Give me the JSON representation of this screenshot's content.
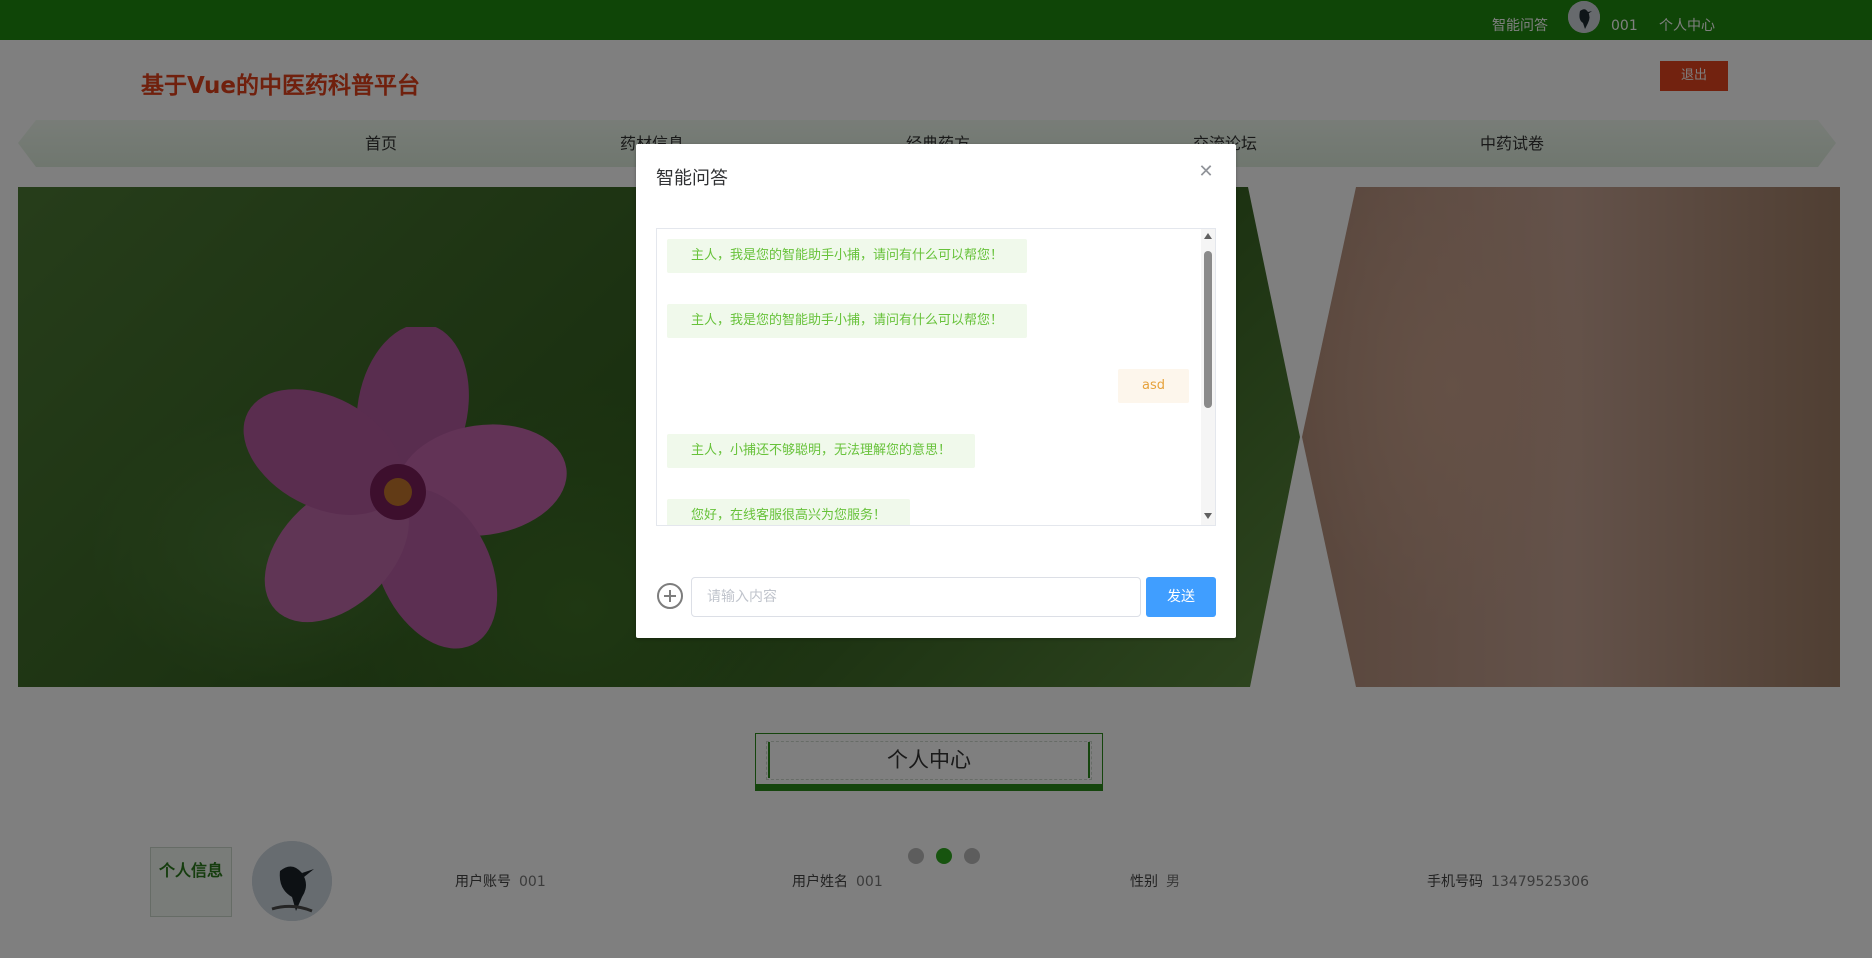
{
  "topbar": {
    "qa_link": "智能问答",
    "username": "001",
    "personal_center_link": "个人中心"
  },
  "header": {
    "site_title": "基于Vue的中医药科普平台",
    "logout_label": "退出"
  },
  "nav": {
    "items": [
      {
        "label": "首页"
      },
      {
        "label": "药材信息"
      },
      {
        "label": "经典药方"
      },
      {
        "label": "交流论坛"
      },
      {
        "label": "中药试卷"
      }
    ]
  },
  "carousel": {
    "slide_count": 3,
    "active_index": 1
  },
  "section": {
    "title": "个人中心"
  },
  "profile": {
    "tag": "个人信息",
    "fields": [
      {
        "label": "用户账号",
        "value": "001"
      },
      {
        "label": "用户姓名",
        "value": "001"
      },
      {
        "label": "性别",
        "value": "男"
      },
      {
        "label": "手机号码",
        "value": "13479525306"
      }
    ]
  },
  "dialog": {
    "title": "智能问答",
    "messages": [
      {
        "from": "bot",
        "text": "主人，我是您的智能助手小捕，请问有什么可以帮您！"
      },
      {
        "from": "bot",
        "text": "主人，我是您的智能助手小捕，请问有什么可以帮您！"
      },
      {
        "from": "user",
        "text": "asd"
      },
      {
        "from": "bot",
        "text": "主人，小捕还不够聪明，无法理解您的意思！"
      },
      {
        "from": "bot",
        "text": "您好，在线客服很高兴为您服务！"
      }
    ],
    "input_placeholder": "请输入内容",
    "input_value": "",
    "send_label": "发送"
  },
  "colors": {
    "topbar": "#1e8a0e",
    "title": "#e0411b",
    "logout": "#e5441e",
    "send": "#409eff",
    "bot_bubble_text": "#67c23a",
    "user_bubble_text": "#e6a23c"
  }
}
